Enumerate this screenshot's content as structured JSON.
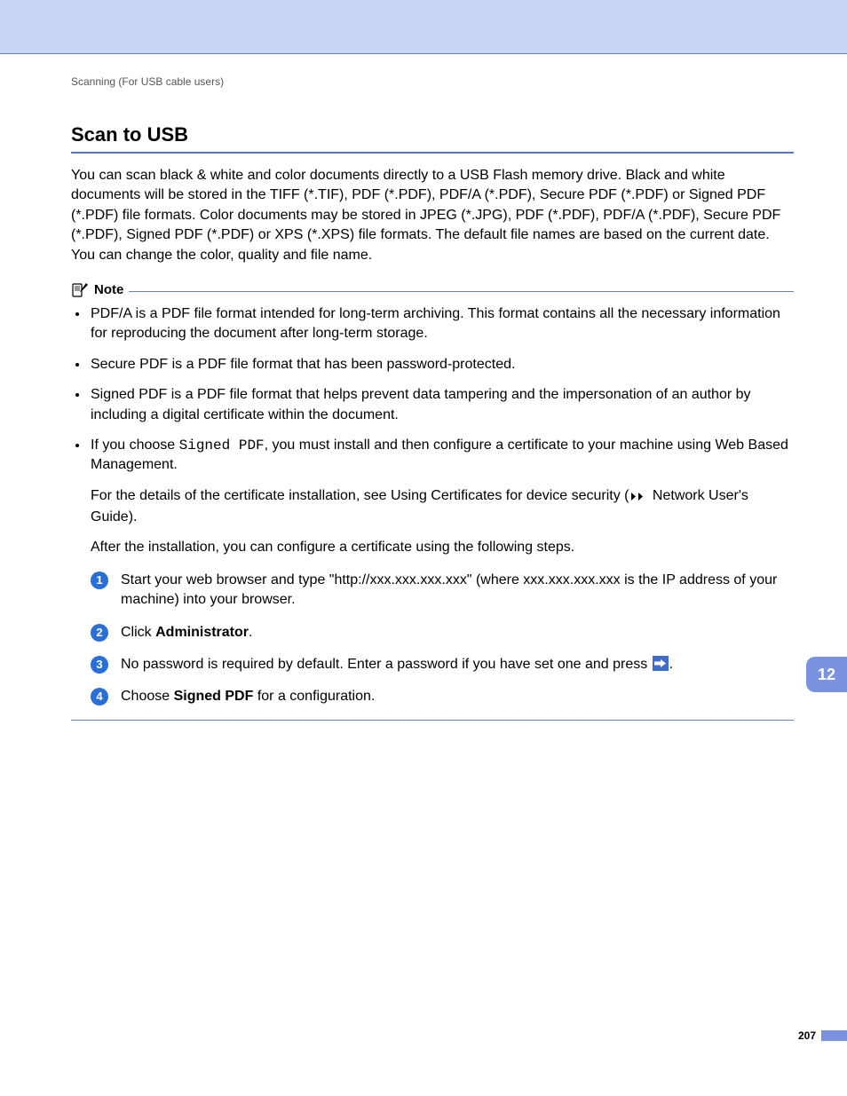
{
  "header": {
    "breadcrumb": "Scanning (For USB cable users)"
  },
  "section": {
    "title": "Scan to USB",
    "intro": "You can scan black & white and color documents directly to a USB Flash memory drive. Black and white documents will be stored in the TIFF (*.TIF), PDF (*.PDF), PDF/A (*.PDF), Secure PDF (*.PDF) or Signed PDF (*.PDF) file formats. Color documents may be stored in JPEG (*.JPG), PDF (*.PDF), PDF/A (*.PDF), Secure PDF (*.PDF), Signed PDF (*.PDF) or XPS (*.XPS) file formats. The default file names are based on the current date. You can change the color, quality and file name."
  },
  "note": {
    "label": "Note",
    "items": {
      "0": "PDF/A is a PDF file format intended for long-term archiving. This format contains all the necessary information for reproducing the document after long-term storage.",
      "1": "Secure PDF is a PDF file format that has been password-protected.",
      "2": "Signed PDF is a PDF file format that helps prevent data tampering and the impersonation of an author by including a digital certificate within the document.",
      "3_pre": "If you choose ",
      "3_mono": "Signed PDF",
      "3_post": ", you must install and then configure a certificate to your machine using Web Based Management.",
      "3_sub1_pre": "For the details of the certificate installation, see Using Certificates for device security (",
      "3_sub1_post": " Network User's Guide).",
      "3_sub2": "After the installation, you can configure a certificate using the following steps."
    },
    "steps": {
      "1": "Start your web browser and type \"http://xxx.xxx.xxx.xxx\" (where xxx.xxx.xxx.xxx is the IP address of your machine) into your browser.",
      "2_pre": "Click ",
      "2_bold": "Administrator",
      "2_post": ".",
      "3_pre": "No password is required by default. Enter a password if you have set one and press ",
      "3_post": ".",
      "4_pre": "Choose ",
      "4_bold": "Signed PDF",
      "4_post": " for a configuration."
    }
  },
  "chapter": "12",
  "page_number": "207"
}
